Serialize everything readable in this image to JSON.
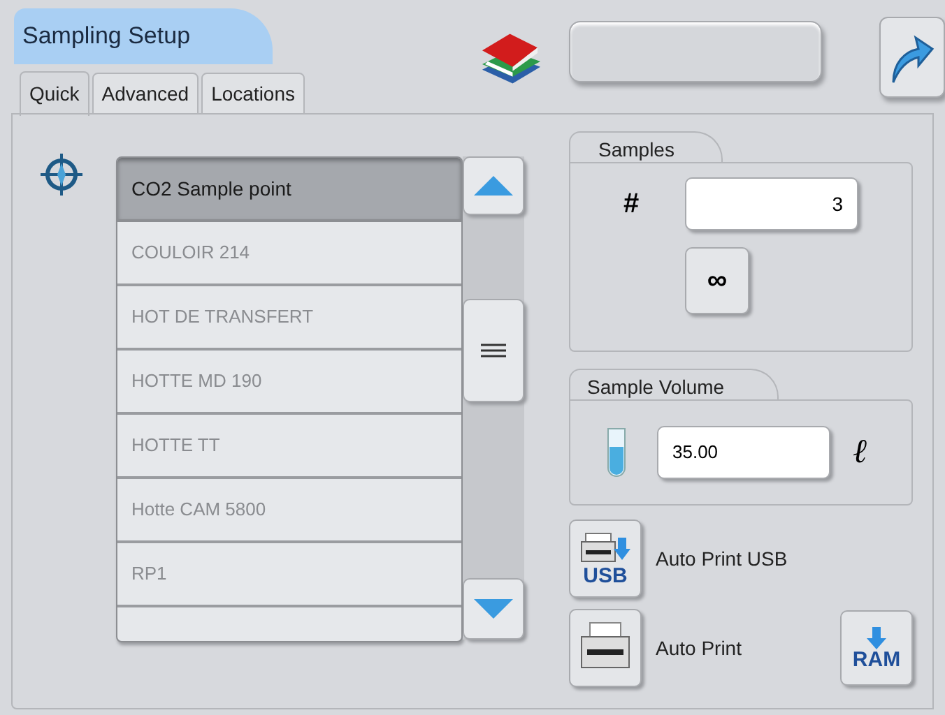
{
  "window": {
    "title": "Sampling Setup"
  },
  "tabs": [
    {
      "label": "Quick",
      "selected": true
    },
    {
      "label": "Advanced",
      "selected": false
    },
    {
      "label": "Locations",
      "selected": false
    }
  ],
  "locations": [
    {
      "label": "CO2 Sample point",
      "selected": true
    },
    {
      "label": "COULOIR 214",
      "selected": false
    },
    {
      "label": "HOT DE TRANSFERT",
      "selected": false
    },
    {
      "label": "HOTTE MD 190",
      "selected": false
    },
    {
      "label": "HOTTE TT",
      "selected": false
    },
    {
      "label": "Hotte CAM 5800",
      "selected": false
    },
    {
      "label": "RP1",
      "selected": false
    }
  ],
  "samples": {
    "title": "Samples",
    "count_label": "#",
    "count": "3",
    "infinite_button": "∞"
  },
  "sample_volume": {
    "title": "Sample Volume",
    "value": "35.00",
    "unit": "ℓ"
  },
  "auto_print_usb": {
    "icon_text": "USB",
    "label": "Auto Print USB"
  },
  "auto_print": {
    "label": "Auto Print"
  },
  "ram_button": {
    "icon_text": "RAM"
  }
}
